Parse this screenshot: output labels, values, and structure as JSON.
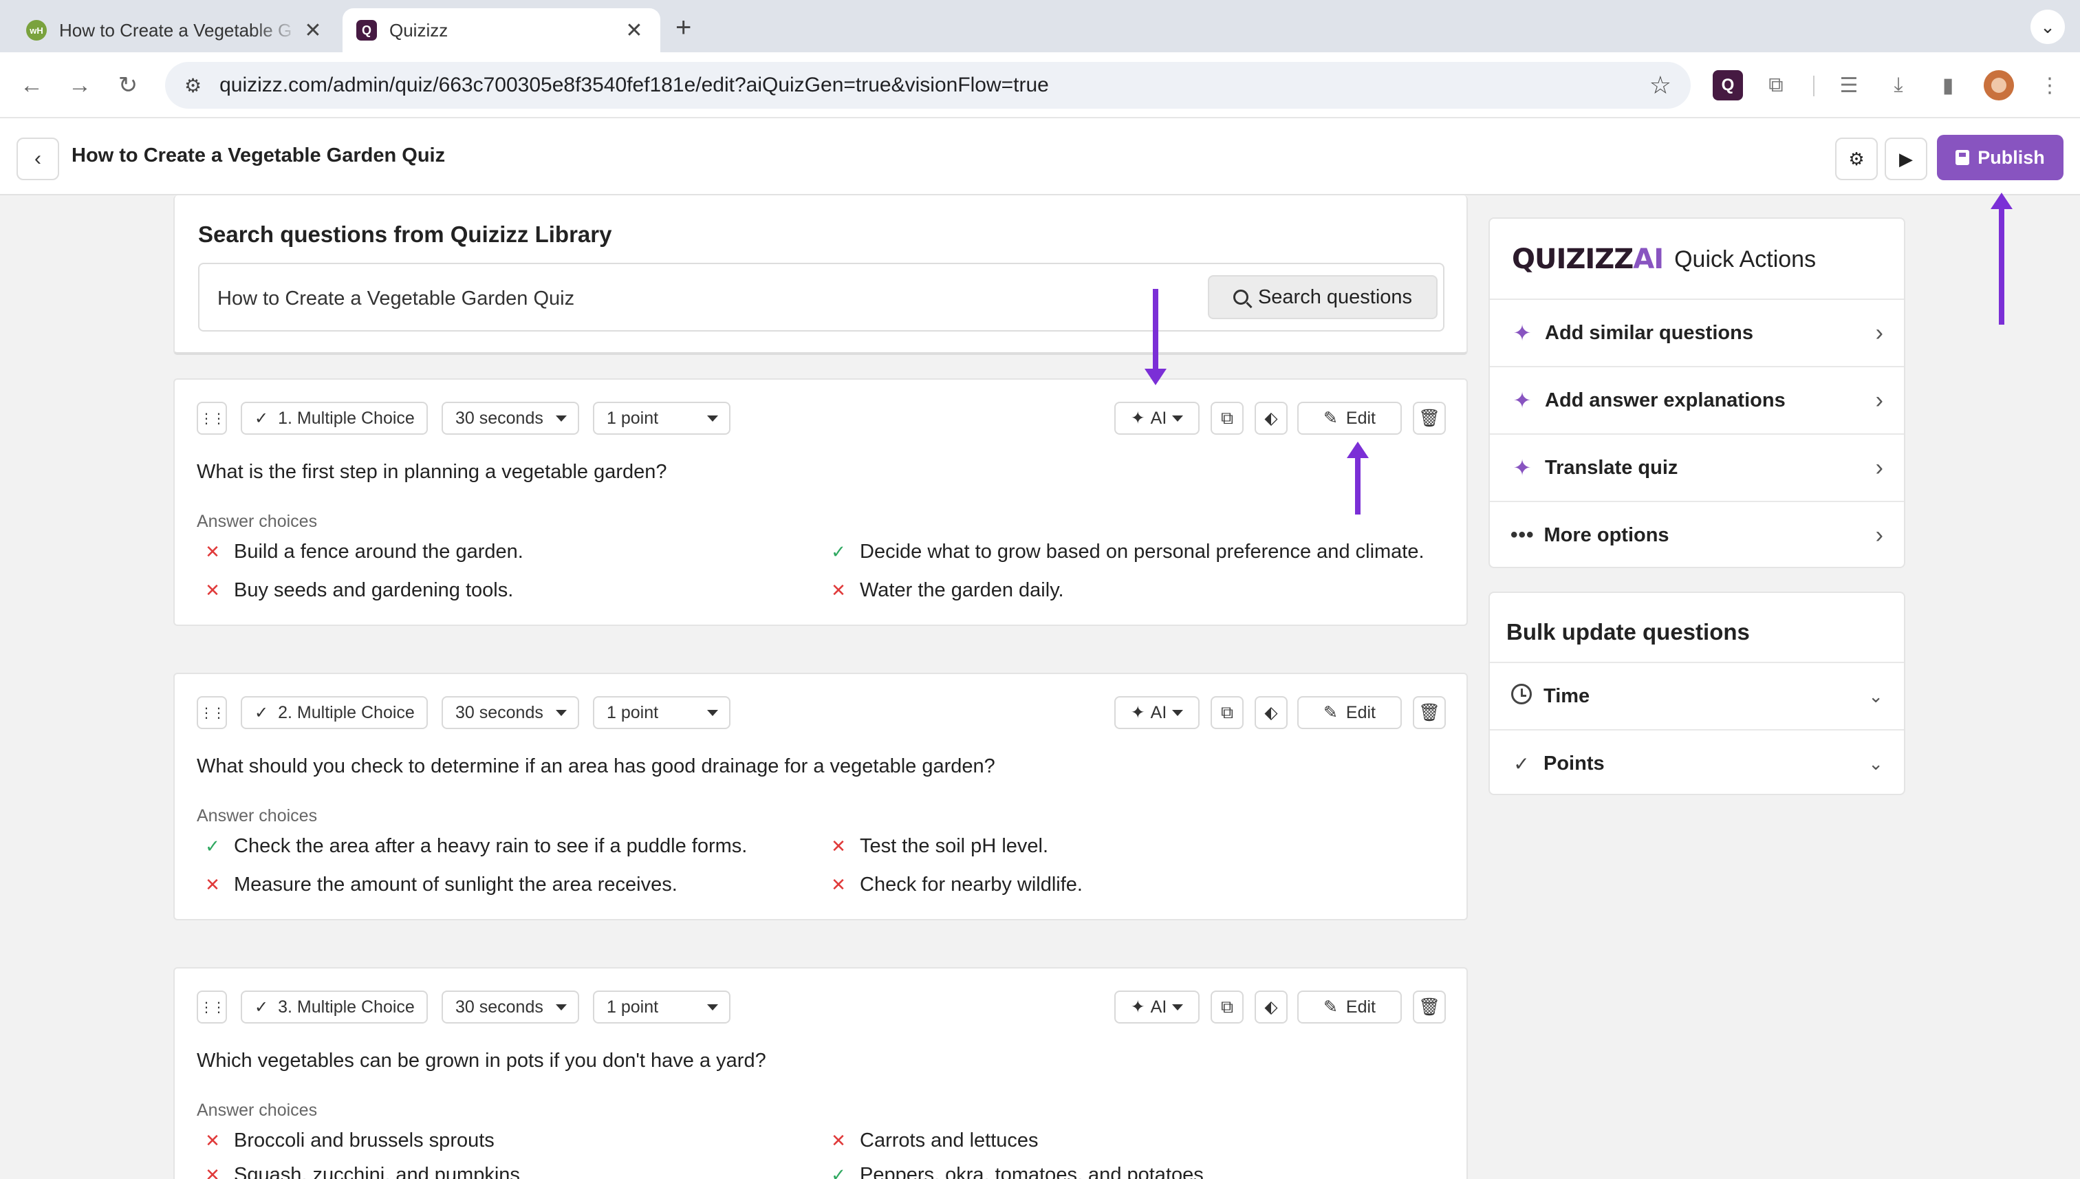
{
  "browser": {
    "tabs": [
      {
        "title": "How to Create a Vegetable G",
        "favicon": "wikihow-icon",
        "active": false
      },
      {
        "title": "Quizizz",
        "favicon": "quizizz-icon",
        "active": true
      }
    ],
    "url": "quizizz.com/admin/quiz/663c700305e8f3540fef181e/edit?aiQuizGen=true&visionFlow=true"
  },
  "header": {
    "title": "How to Create a Vegetable Garden Quiz",
    "publish_label": "Publish"
  },
  "search": {
    "heading": "Search questions from Quizizz Library",
    "value": "How to Create a Vegetable Garden Quiz",
    "button_label": "Search questions"
  },
  "labels": {
    "answer_choices": "Answer choices",
    "ai": "AI",
    "edit": "Edit"
  },
  "questions": [
    {
      "type": "1. Multiple Choice",
      "time": "30 seconds",
      "points": "1 point",
      "text": "What is the first step in planning a vegetable garden?",
      "answers": [
        {
          "text": "Build a fence around the garden.",
          "correct": false
        },
        {
          "text": "Decide what to grow based on personal preference and climate.",
          "correct": true
        },
        {
          "text": "Buy seeds and gardening tools.",
          "correct": false
        },
        {
          "text": "Water the garden daily.",
          "correct": false
        }
      ]
    },
    {
      "type": "2. Multiple Choice",
      "time": "30 seconds",
      "points": "1 point",
      "text": "What should you check to determine if an area has good drainage for a vegetable garden?",
      "answers": [
        {
          "text": "Check the area after a heavy rain to see if a puddle forms.",
          "correct": true
        },
        {
          "text": "Test the soil pH level.",
          "correct": false
        },
        {
          "text": "Measure the amount of sunlight the area receives.",
          "correct": false
        },
        {
          "text": "Check for nearby wildlife.",
          "correct": false
        }
      ]
    },
    {
      "type": "3. Multiple Choice",
      "time": "30 seconds",
      "points": "1 point",
      "text": "Which vegetables can be grown in pots if you don't have a yard?",
      "answers": [
        {
          "text": "Broccoli and brussels sprouts",
          "correct": false
        },
        {
          "text": "Carrots and lettuces",
          "correct": false
        },
        {
          "text": "Squash, zucchini, and pumpkins",
          "correct": false
        },
        {
          "text": "Peppers, okra, tomatoes, and potatoes",
          "correct": true
        }
      ]
    }
  ],
  "quick_actions": {
    "logo_text": "QUIZIZZ",
    "logo_ai": "AI",
    "title": "Quick Actions",
    "items": [
      {
        "label": "Add similar questions",
        "icon": "sparkle-icon"
      },
      {
        "label": "Add answer explanations",
        "icon": "sparkle-icon"
      },
      {
        "label": "Translate quiz",
        "icon": "sparkle-icon"
      },
      {
        "label": "More options",
        "icon": "ellipsis-icon"
      }
    ]
  },
  "bulk_update": {
    "title": "Bulk update questions",
    "items": [
      {
        "label": "Time",
        "icon": "clock-icon"
      },
      {
        "label": "Points",
        "icon": "check-icon"
      }
    ]
  },
  "colors": {
    "accent": "#8854c0",
    "annotation_arrow": "#7b2fd6",
    "correct": "#2fa860",
    "incorrect": "#e03a3a"
  }
}
